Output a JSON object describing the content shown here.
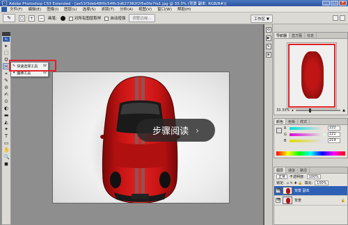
{
  "window": {
    "title": "Adobe Photoshop CS3 Extended - [ae51f3deb48f0c54ffc3d627382f2f5e0fe7fa1.jpg @ 33.3% (背景 副本, RGB/8#)]",
    "badge": "Ps",
    "min": "_",
    "max": "□",
    "close": "✕"
  },
  "menubar": {
    "items": [
      "文件(F)",
      "编辑(E)",
      "图像(I)",
      "图层(L)",
      "选择(S)",
      "滤镜(T)",
      "分析(A)",
      "视图(V)",
      "窗口(W)",
      "帮助(H)"
    ]
  },
  "options": {
    "brush_label": "画笔:",
    "sample_all": "对所有图层取样",
    "auto_enhance": "自动增强",
    "refine_edge": "调整边缘...",
    "workspace": "工作区 ▼"
  },
  "toolbox": {
    "ps": "Ps",
    "tools": [
      "▸",
      "⬚",
      "ʘ",
      "✂",
      "⌖",
      "✎",
      "⊘",
      "✍",
      "⊙",
      "◐",
      "▬",
      "◭",
      "✦",
      "T",
      "▭",
      "✋",
      "🔍",
      "◼"
    ]
  },
  "flyout": {
    "items": [
      {
        "label": "快速选择工具",
        "key": "W"
      },
      {
        "label": "魔棒工具",
        "key": "W"
      }
    ]
  },
  "overlay": {
    "label": "步骤阅读",
    "chevron": "›"
  },
  "navigator": {
    "tabs": [
      "导航器",
      "直方图",
      "信息"
    ],
    "zoom": "33.33%"
  },
  "color": {
    "tabs": [
      "颜色",
      "色板",
      "样式"
    ],
    "channels": [
      {
        "label": "R",
        "value": "222"
      },
      {
        "label": "G",
        "value": "221"
      },
      {
        "label": "B",
        "value": "219"
      }
    ]
  },
  "layers": {
    "tabs": [
      "图层",
      "通道",
      "路径"
    ],
    "blend_mode": "正常",
    "opacity_label": "不透明度:",
    "opacity_value": "100%",
    "lock_label": "锁定:",
    "fill_label": "填充:",
    "fill_value": "100%",
    "rows": [
      {
        "name": "背景 副本",
        "selected": true
      },
      {
        "name": "背景",
        "selected": false
      }
    ]
  },
  "colors": {
    "highlight": "#e0202a",
    "car_red": "#c01515",
    "selected_layer": "#2d5fb5"
  }
}
